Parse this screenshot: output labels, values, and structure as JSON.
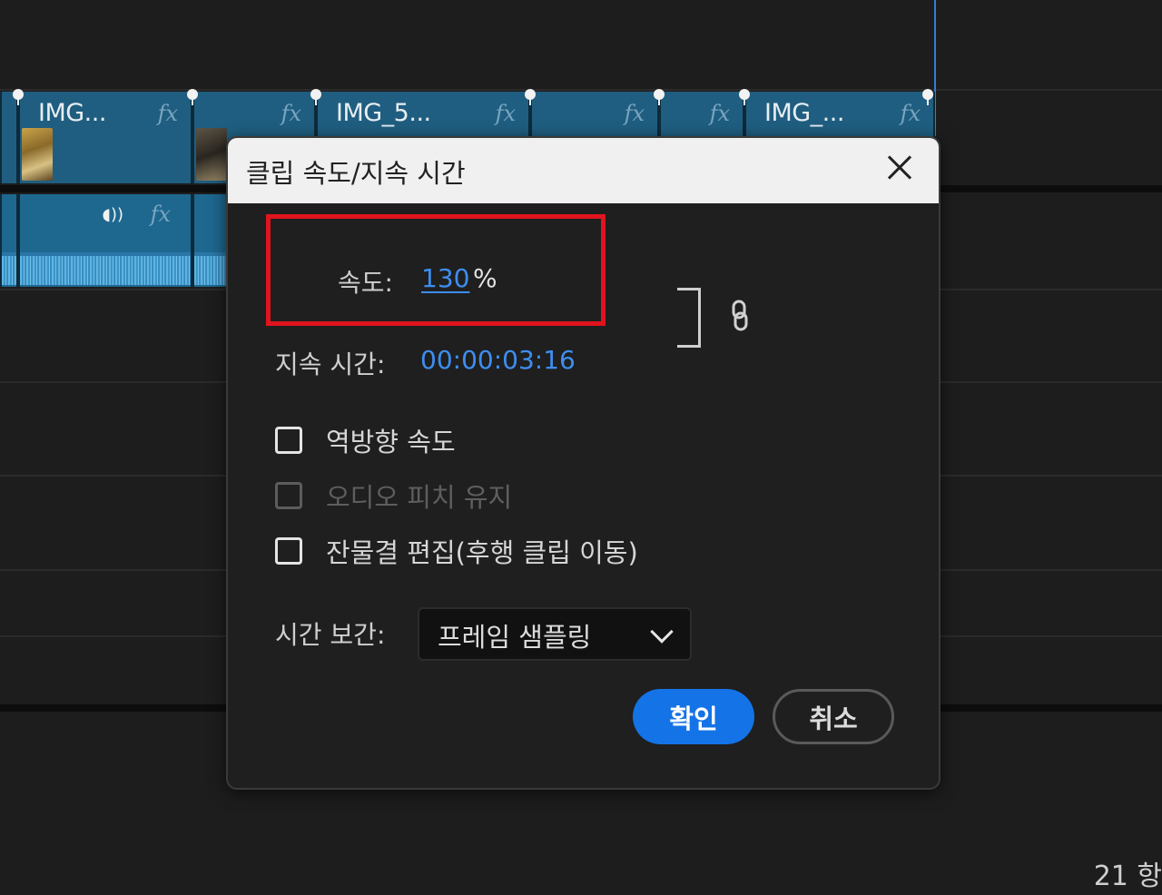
{
  "timeline": {
    "video_clips": [
      {
        "name": "IMG...",
        "fx": "fx"
      },
      {
        "name": "",
        "fx": "fx"
      },
      {
        "name": "IMG_5...",
        "fx": "fx"
      },
      {
        "name": "",
        "fx": "fx"
      },
      {
        "name": "",
        "fx": "fx"
      },
      {
        "name": "IMG_...",
        "fx": "fx"
      }
    ],
    "audio_fx": "fx",
    "corner_label": "21 항"
  },
  "dialog": {
    "title": "클립 속도/지속 시간",
    "speed_label": "속도:",
    "speed_value": "130",
    "speed_unit": "%",
    "duration_label": "지속 시간:",
    "duration_value": "00:00:03:16",
    "checkboxes": [
      {
        "label": "역방향 속도",
        "checked": false,
        "enabled": true
      },
      {
        "label": "오디오 피치 유지",
        "checked": false,
        "enabled": false
      },
      {
        "label": "잔물결 편집(후행 클립 이동)",
        "checked": false,
        "enabled": true
      }
    ],
    "interpolation_label": "시간 보간:",
    "interpolation_value": "프레임 샘플링",
    "ok_label": "확인",
    "cancel_label": "취소"
  },
  "colors": {
    "accent": "#1473e6",
    "value_blue": "#3d8ef0",
    "highlight_red": "#e0141e",
    "clip_blue": "#1f5e80"
  }
}
